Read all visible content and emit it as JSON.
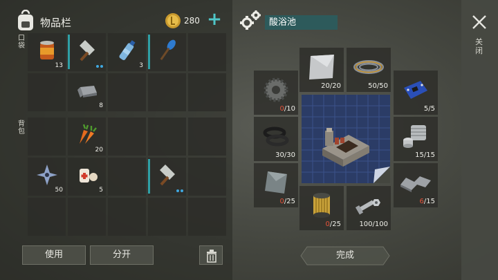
{
  "inventory": {
    "title": "物品栏",
    "coins": "280",
    "plus": "+",
    "pocket_label": "口袋",
    "backpack_label": "背包",
    "pocket_slots": [
      {
        "icon": "canned-food-icon",
        "qty": "13"
      },
      {
        "icon": "cleaver-icon",
        "qty": "",
        "bar": true,
        "dots": true
      },
      {
        "icon": "water-bottle-icon",
        "qty": "3"
      },
      {
        "icon": "paddle-icon",
        "qty": "",
        "bar": true
      },
      {
        "icon": "",
        "qty": ""
      },
      {
        "icon": "",
        "qty": ""
      },
      {
        "icon": "iron-ingot-icon",
        "qty": "8"
      },
      {
        "icon": "",
        "qty": ""
      },
      {
        "icon": "",
        "qty": ""
      },
      {
        "icon": "",
        "qty": ""
      }
    ],
    "backpack_slots": [
      {
        "icon": "",
        "qty": ""
      },
      {
        "icon": "carrot-icon",
        "qty": "20"
      },
      {
        "icon": "",
        "qty": ""
      },
      {
        "icon": "",
        "qty": ""
      },
      {
        "icon": "",
        "qty": ""
      },
      {
        "icon": "shuriken-icon",
        "qty": "50"
      },
      {
        "icon": "bandage-icon",
        "qty": "5"
      },
      {
        "icon": "",
        "qty": ""
      },
      {
        "icon": "cleaver-icon",
        "qty": "",
        "bar": true,
        "dots": true
      },
      {
        "icon": "",
        "qty": ""
      },
      {
        "icon": "",
        "qty": ""
      },
      {
        "icon": "",
        "qty": ""
      },
      {
        "icon": "",
        "qty": ""
      },
      {
        "icon": "",
        "qty": ""
      },
      {
        "icon": "",
        "qty": ""
      }
    ],
    "use_button": "使用",
    "split_button": "分开"
  },
  "crafting": {
    "title": "酸浴池",
    "done_button": "完成",
    "parts": [
      {
        "id": "metal-sheet",
        "icon": "metal-sheet-icon",
        "have": "20",
        "need": "20",
        "lacking": false
      },
      {
        "id": "wire",
        "icon": "wire-coil-icon",
        "have": "50",
        "need": "50",
        "lacking": false
      },
      {
        "id": "gear",
        "icon": "gear-part-icon",
        "have": "0",
        "need": "10",
        "lacking": true
      },
      {
        "id": "circuit",
        "icon": "circuit-board-icon",
        "have": "5",
        "need": "5",
        "lacking": false
      },
      {
        "id": "rubber-ring",
        "icon": "rubber-ring-icon",
        "have": "30",
        "need": "30",
        "lacking": false
      },
      {
        "id": "engine-part",
        "icon": "engine-cylinder-icon",
        "have": "15",
        "need": "15",
        "lacking": false
      },
      {
        "id": "plate",
        "icon": "steel-plate-icon",
        "have": "0",
        "need": "25",
        "lacking": true
      },
      {
        "id": "metal-bar",
        "icon": "metal-bar-icon",
        "have": "6",
        "need": "15",
        "lacking": true
      },
      {
        "id": "filter",
        "icon": "filter-icon",
        "have": "0",
        "need": "25",
        "lacking": true
      },
      {
        "id": "bolts",
        "icon": "bolt-nut-icon",
        "have": "100",
        "need": "100",
        "lacking": false
      }
    ],
    "lack_color": "#e5533a"
  },
  "close_label": "关闭"
}
